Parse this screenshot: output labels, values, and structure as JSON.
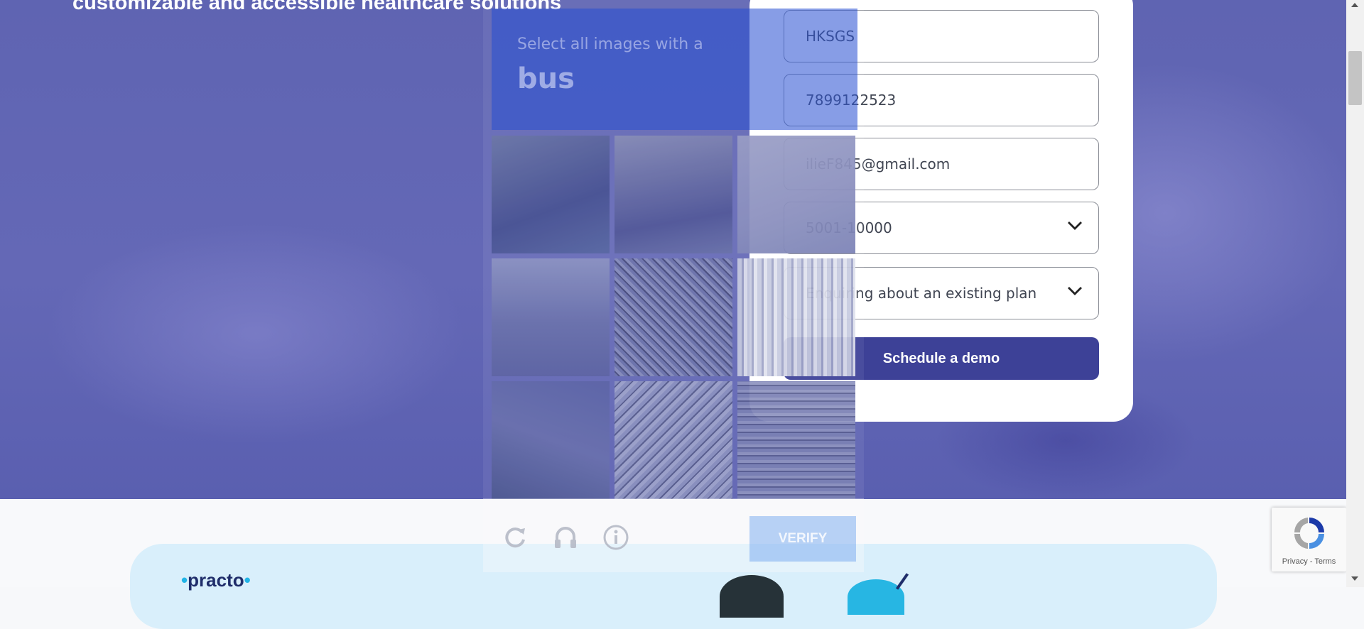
{
  "hero": {
    "headline": "customizable and accessible healthcare solutions"
  },
  "form": {
    "name_value": "HKSGS",
    "phone_value": "7899122523",
    "email_value": "ilieF845@gmail.com",
    "size_select_value": "5001-10000",
    "reason_select_value": "Enquiring about an existing plan",
    "submit_label": "Schedule a demo"
  },
  "captcha": {
    "instruction": "Select all images with a",
    "target": "bus",
    "verify_label": "VERIFY",
    "icons": [
      "reload-icon",
      "audio-icon",
      "info-icon"
    ]
  },
  "banner": {
    "logo_text": "practo"
  },
  "recaptcha_badge": {
    "privacy_label": "Privacy",
    "separator": " - ",
    "terms_label": "Terms"
  },
  "colors": {
    "hero_bg": "#6367b5",
    "primary_button": "#3d4197",
    "banner_bg": "#d9effb",
    "captcha_header": "#2850d2"
  }
}
